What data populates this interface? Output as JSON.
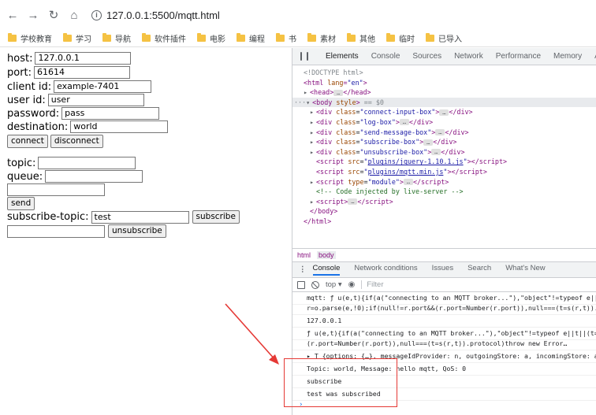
{
  "browser": {
    "url": "127.0.0.1:5500/mqtt.html",
    "bookmarks": [
      "学校教育",
      "学习",
      "导航",
      "软件插件",
      "电影",
      "编程",
      "书",
      "素材",
      "其他",
      "临时",
      "已导入"
    ]
  },
  "form": {
    "host": {
      "label": "host:",
      "value": "127.0.0.1"
    },
    "port": {
      "label": "port:",
      "value": "61614"
    },
    "client_id": {
      "label": "client id:",
      "value": "example-7401"
    },
    "user_id": {
      "label": "user id:",
      "value": "user"
    },
    "password": {
      "label": "password:",
      "value": "pass"
    },
    "destination": {
      "label": "destination:",
      "value": "world"
    },
    "connect_label": "connect",
    "disconnect_label": "disconnect",
    "topic": {
      "label": "topic:",
      "value": ""
    },
    "queue": {
      "label": "queue:",
      "value": ""
    },
    "message_value": "",
    "send_label": "send",
    "subscribe_topic": {
      "label": "subscribe-topic:",
      "value": "test"
    },
    "subscribe_label": "subscribe",
    "unsubscribe_value": "",
    "unsubscribe_label": "unsubscribe"
  },
  "devtools": {
    "tabs": [
      "Elements",
      "Console",
      "Sources",
      "Network",
      "Performance",
      "Memory",
      "Ap"
    ],
    "active_tab": "Elements",
    "elements": {
      "doctype": "<!DOCTYPE html>",
      "html_open_tag": "html",
      "html_lang_attr": "lang",
      "html_lang_val": "\"en\"",
      "head": "head",
      "body_line_suffix": " == $0",
      "body_style_attr": "style",
      "divs": [
        "connect-input-box",
        "log-box",
        "send-message-box",
        "subscribe-box",
        "unsubscribe-box"
      ],
      "scripts": [
        "plugins/jquery-1.10.1.js",
        "plugins/mqtt.min.js"
      ],
      "module_type": "\"module\"",
      "comment": "<!-- Code injected by live-server -->"
    },
    "crumbs": [
      "html",
      "body"
    ],
    "drawer_tabs": [
      "Console",
      "Network conditions",
      "Issues",
      "Search",
      "What's New"
    ],
    "context": "top",
    "filter_placeholder": "Filter",
    "console_lines": [
      "mqtt:  ƒ u(e,t){if(a(\"connecting to an MQTT broker...\"),\"object\"!=typeof e||",
      "r=o.parse(e,!0);if(null!=r.port&&(r.port=Number(r.port)),null===(t=s(r,t)).",
      "127.0.0.1",
      "ƒ u(e,t){if(a(\"connecting to an MQTT broker...\"),\"object\"!=typeof e||t||(t=",
      "(r.port=Number(r.port)),null===(t=s(r,t)).protocol)throw new Error…",
      "▸ T {options: {…}, messageIdProvider: n, outgoingStore: a, incomingStore: a",
      "Topic: world, Message: hello mqtt, QoS: 0",
      "subscribe",
      "test was subscribed"
    ]
  },
  "colors": {
    "annotation": "#e53935",
    "folder": "#f5c243"
  }
}
